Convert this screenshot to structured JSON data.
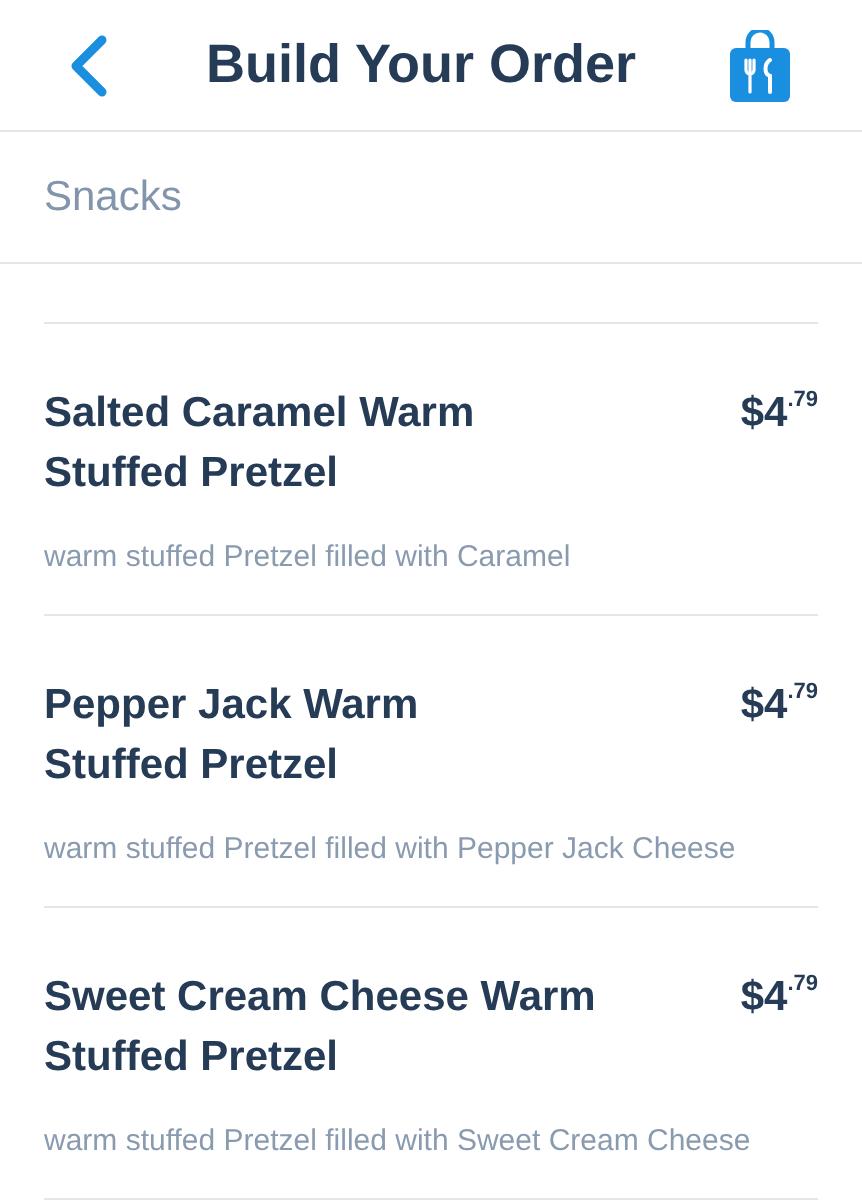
{
  "header": {
    "title": "Build Your Order"
  },
  "section": {
    "title": "Snacks"
  },
  "items": [
    {
      "name": "Salted Caramel Warm\nStuffed Pretzel",
      "price": "$4$^{.79}$",
      "description": "warm stuffed Pretzel filled with Caramel"
    },
    {
      "name": "Pepper Jack Warm\nStuffed Pretzel",
      "price": "$4$^{.79}$",
      "description": "warm stuffed Pretzel filled with Pepper Jack Cheese"
    },
    {
      "name": "Sweet Cream Cheese Warm\nStuffed Pretzel",
      "price": "$4$^{.79}$",
      "description": "warm stuffed Pretzel filled with Sweet Cream Cheese"
    }
  ]
}
